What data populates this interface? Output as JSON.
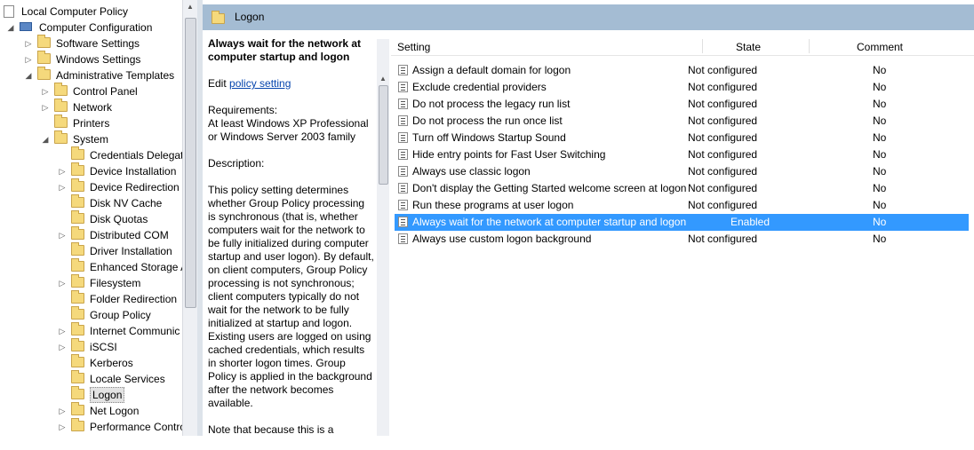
{
  "tree": {
    "root": "Local Computer Policy",
    "computer_config": "Computer Configuration",
    "software_settings": "Software Settings",
    "windows_settings": "Windows Settings",
    "admin_templates": "Administrative Templates",
    "control_panel": "Control Panel",
    "network": "Network",
    "printers": "Printers",
    "system": "System",
    "system_children": [
      "Credentials Delegati",
      "Device Installation",
      "Device Redirection",
      "Disk NV Cache",
      "Disk Quotas",
      "Distributed COM",
      "Driver Installation",
      "Enhanced Storage A",
      "Filesystem",
      "Folder Redirection",
      "Group Policy",
      "Internet Communic",
      "iSCSI",
      "Kerberos",
      "Locale Services",
      "Logon",
      "Net Logon",
      "Performance Contro"
    ],
    "selected": "Logon"
  },
  "header": {
    "title": "Logon"
  },
  "description": {
    "title": "Always wait for the network at computer startup and logon",
    "edit_prefix": "Edit",
    "edit_link": "policy setting",
    "requirements_label": "Requirements:",
    "requirements_text": "At least Windows XP Professional or Windows Server 2003 family",
    "description_label": "Description:",
    "body": "This policy setting determines whether Group Policy processing is synchronous (that is, whether computers wait for the network to be fully initialized during computer startup and user logon). By default, on client computers, Group Policy processing is not synchronous; client computers typically do not wait for the network to be fully initialized at startup and logon. Existing users are logged on using cached credentials, which results in shorter logon times. Group Policy is applied in the background after the network becomes available.",
    "tail": "Note that because this is a"
  },
  "list": {
    "columns": {
      "setting": "Setting",
      "state": "State",
      "comment": "Comment"
    },
    "rows": [
      {
        "setting": "Assign a default domain for logon",
        "state": "Not configured",
        "comment": "No"
      },
      {
        "setting": "Exclude credential providers",
        "state": "Not configured",
        "comment": "No"
      },
      {
        "setting": "Do not process the legacy run list",
        "state": "Not configured",
        "comment": "No"
      },
      {
        "setting": "Do not process the run once list",
        "state": "Not configured",
        "comment": "No"
      },
      {
        "setting": "Turn off Windows Startup Sound",
        "state": "Not configured",
        "comment": "No"
      },
      {
        "setting": "Hide entry points for Fast User Switching",
        "state": "Not configured",
        "comment": "No"
      },
      {
        "setting": "Always use classic logon",
        "state": "Not configured",
        "comment": "No"
      },
      {
        "setting": "Don't display the Getting Started welcome screen at logon",
        "state": "Not configured",
        "comment": "No"
      },
      {
        "setting": "Run these programs at user logon",
        "state": "Not configured",
        "comment": "No"
      },
      {
        "setting": "Always wait for the network at computer startup and logon",
        "state": "Enabled",
        "comment": "No"
      },
      {
        "setting": "Always use custom logon background",
        "state": "Not configured",
        "comment": "No"
      }
    ],
    "selected_index": 9
  },
  "colors": {
    "header_bg": "#a4bcd3",
    "selection": "#3399ff",
    "link": "#0645ad"
  }
}
